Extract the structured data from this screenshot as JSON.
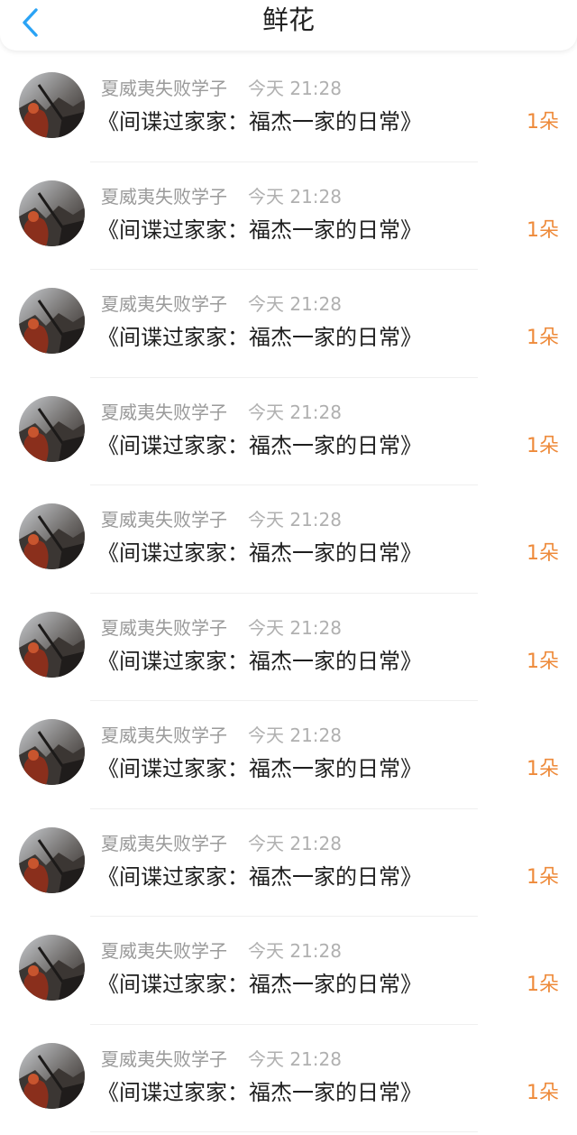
{
  "header": {
    "title": "鲜花",
    "back_icon": "chevron-left-icon",
    "accent_color": "#2aa3f5"
  },
  "gift_color": "#ee8a3a",
  "records": [
    {
      "user": "夏威夷失败学子",
      "time": "今天 21:28",
      "book": "《间谍过家家：福杰一家的日常》",
      "count": "1朵"
    },
    {
      "user": "夏威夷失败学子",
      "time": "今天 21:28",
      "book": "《间谍过家家：福杰一家的日常》",
      "count": "1朵"
    },
    {
      "user": "夏威夷失败学子",
      "time": "今天 21:28",
      "book": "《间谍过家家：福杰一家的日常》",
      "count": "1朵"
    },
    {
      "user": "夏威夷失败学子",
      "time": "今天 21:28",
      "book": "《间谍过家家：福杰一家的日常》",
      "count": "1朵"
    },
    {
      "user": "夏威夷失败学子",
      "time": "今天 21:28",
      "book": "《间谍过家家：福杰一家的日常》",
      "count": "1朵"
    },
    {
      "user": "夏威夷失败学子",
      "time": "今天 21:28",
      "book": "《间谍过家家：福杰一家的日常》",
      "count": "1朵"
    },
    {
      "user": "夏威夷失败学子",
      "time": "今天 21:28",
      "book": "《间谍过家家：福杰一家的日常》",
      "count": "1朵"
    },
    {
      "user": "夏威夷失败学子",
      "time": "今天 21:28",
      "book": "《间谍过家家：福杰一家的日常》",
      "count": "1朵"
    },
    {
      "user": "夏威夷失败学子",
      "time": "今天 21:28",
      "book": "《间谍过家家：福杰一家的日常》",
      "count": "1朵"
    },
    {
      "user": "夏威夷失败学子",
      "time": "今天 21:28",
      "book": "《间谍过家家：福杰一家的日常》",
      "count": "1朵"
    }
  ]
}
